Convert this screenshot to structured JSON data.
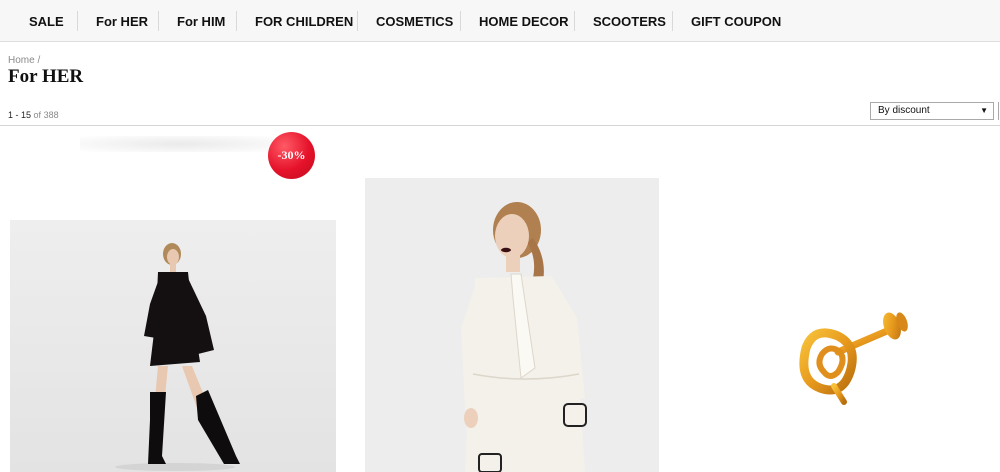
{
  "nav": {
    "items": [
      {
        "label": "SALE"
      },
      {
        "label": "For HER"
      },
      {
        "label": "For HIM"
      },
      {
        "label": "FOR CHILDREN"
      },
      {
        "label": "COSMETICS"
      },
      {
        "label": "HOME DECOR"
      },
      {
        "label": "SCOOTERS"
      },
      {
        "label": "GIFT COUPON"
      }
    ]
  },
  "breadcrumb": {
    "home": "Home",
    "separator": "/"
  },
  "page": {
    "title": "For HER"
  },
  "results": {
    "range": "1 - 15",
    "of_label": "of",
    "total": "388"
  },
  "sort": {
    "selected": "By discount",
    "caret": "▼"
  },
  "products": [
    {
      "badge": "-30%",
      "image": "woman-black-dress-photo"
    },
    {
      "image": "woman-white-dress-photo"
    },
    {
      "image": "gold-earring-photo"
    }
  ],
  "colors": {
    "badge": "#e5122a",
    "nav_bg": "#f7f7f7"
  }
}
